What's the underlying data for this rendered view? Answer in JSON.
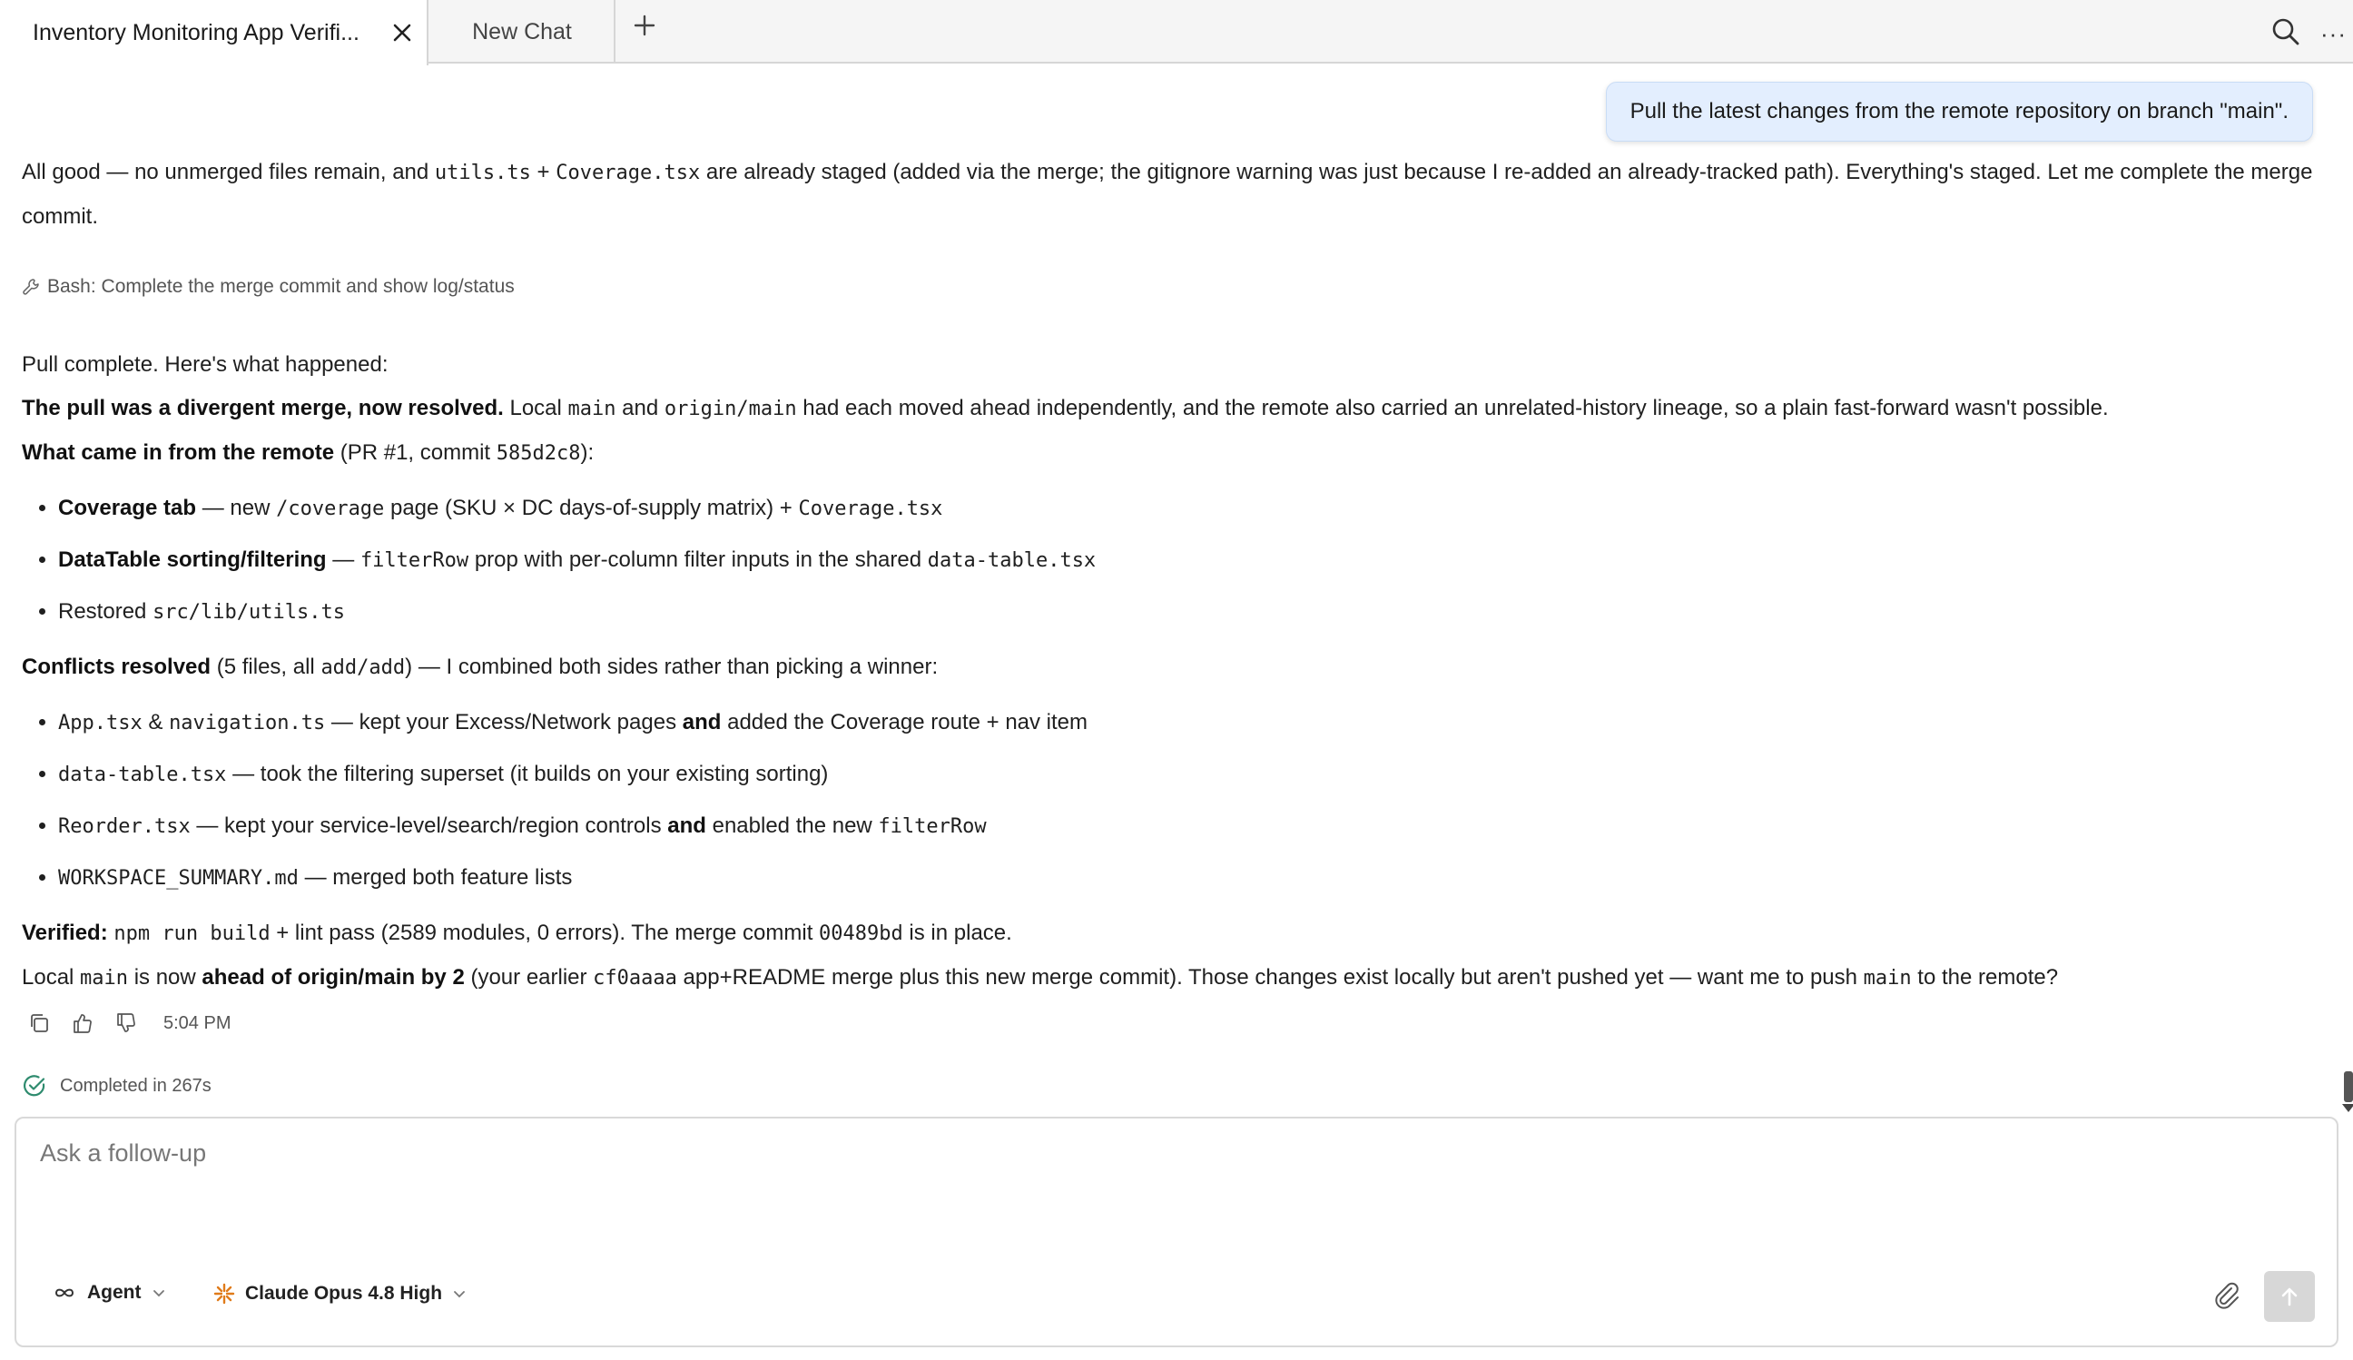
{
  "tabs": [
    {
      "label": "Inventory Monitoring App Verifi...",
      "active": true
    },
    {
      "label": "New Chat",
      "active": false
    }
  ],
  "user_message": "Pull the latest changes from the remote repository on branch \"main\".",
  "intro": {
    "t1": "All good — no unmerged files remain, and ",
    "c1": "utils.ts",
    "t2": " + ",
    "c2": "Coverage.tsx",
    "t3": " are already staged (added via the merge; the gitignore warning was just because I re-added an already-tracked path). Everything's staged. Let me complete the merge commit."
  },
  "tool_call": "Bash: Complete the merge commit and show log/status",
  "summary": {
    "heading": "Pull complete. Here's what happened:",
    "divergent": {
      "bold": "The pull was a divergent merge, now resolved.",
      "t1": " Local ",
      "c1": "main",
      "t2": " and ",
      "c2": "origin/main",
      "t3": " had each moved ahead independently, and the remote also carried an unrelated-history lineage, so a plain fast-forward wasn't possible."
    },
    "remote": {
      "bold": "What came in from the remote",
      "t1": " (PR #1, commit ",
      "c1": "585d2c8",
      "t2": "):"
    },
    "remote_items": [
      {
        "bold": "Coverage tab",
        "t1": " — new ",
        "c1": "/coverage",
        "t2": " page (SKU × DC days-of-supply matrix) + ",
        "c2": "Coverage.tsx"
      },
      {
        "bold": "DataTable sorting/filtering",
        "t1": " — ",
        "c1": "filterRow",
        "t2": " prop with per-column filter inputs in the shared ",
        "c2": "data-table.tsx"
      },
      {
        "t1": "Restored ",
        "c1": "src/lib/utils.ts"
      }
    ],
    "conflicts": {
      "bold": "Conflicts resolved",
      "t1": " (5 files, all ",
      "c1": "add/add",
      "t2": ") — I combined both sides rather than picking a winner:"
    },
    "conflict_items": [
      {
        "c1": "App.tsx",
        "t1": " & ",
        "c2": "navigation.ts",
        "t2": " — kept your Excess/Network pages ",
        "bold": "and",
        "t3": " added the Coverage route + nav item"
      },
      {
        "c1": "data-table.tsx",
        "t1": " — took the filtering superset (it builds on your existing sorting)"
      },
      {
        "c1": "Reorder.tsx",
        "t1": " — kept your service-level/search/region controls ",
        "bold": "and",
        "t2": " enabled the new ",
        "c2": "filterRow"
      },
      {
        "c1": "WORKSPACE_SUMMARY.md",
        "t1": " — merged both feature lists"
      }
    ],
    "verified": {
      "bold": "Verified:",
      "t1": " ",
      "c1": "npm run build",
      "t2": " + lint pass (2589 modules, 0 errors). The merge commit ",
      "c2": "00489bd",
      "t3": " is in place."
    },
    "ahead": {
      "t1": "Local ",
      "c1": "main",
      "t2": " is now ",
      "bold": "ahead of origin/main by 2",
      "t3": " (your earlier ",
      "c2": "cf0aaaa",
      "t4": " app+README merge plus this new merge commit). Those changes exist locally but aren't pushed yet — want me to push ",
      "c3": "main",
      "t5": " to the remote?"
    }
  },
  "message_time": "5:04 PM",
  "completed": "Completed in 267s",
  "composer": {
    "placeholder": "Ask a follow-up",
    "mode": "Agent",
    "model": "Claude Opus 4.8 High"
  },
  "colors": {
    "bubble_bg": "#e3eefe",
    "completed_check": "#2e8b6e",
    "model_spark": "#e07b1a"
  },
  "icons": [
    "close-icon",
    "plus-icon",
    "search-icon",
    "more-icon",
    "wrench-icon",
    "copy-icon",
    "thumbs-up-icon",
    "thumbs-down-icon",
    "check-circle-icon",
    "infinity-icon",
    "spark-icon",
    "chevron-down-icon",
    "paperclip-icon",
    "arrow-up-icon"
  ]
}
